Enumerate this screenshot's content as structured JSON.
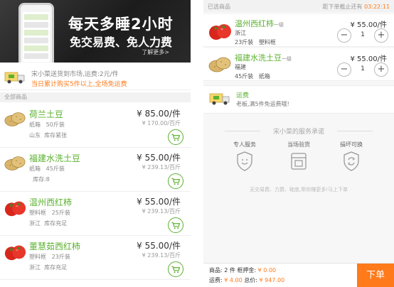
{
  "banner": {
    "title": "每天多睡2小时",
    "subtitle": "免交易费、免人力费",
    "more": "了解更多>"
  },
  "notice": {
    "line1": "宋小菜送货到市场,运费:2元/件",
    "line2": "当日累计购买5件以上,全场免运费"
  },
  "products_header": "全部商品",
  "products": [
    {
      "name": "荷兰土豆",
      "pack": "纸箱",
      "weight": "50斤装",
      "origin": "山东",
      "stock": "库存紧张",
      "price": "¥ 85.00/件",
      "unit_price": "¥ 170.00/百斤",
      "image": "potato"
    },
    {
      "name": "福建水洗土豆",
      "pack": "纸箱",
      "weight": "45斤装",
      "origin": "",
      "stock": "库存:8",
      "price": "¥ 55.00/件",
      "unit_price": "¥ 239.13/百斤",
      "image": "potato"
    },
    {
      "name": "温州西红柿",
      "pack": "塑料框",
      "weight": "25斤装",
      "origin": "浙江",
      "stock": "库存充足",
      "price": "¥ 55.00/件",
      "unit_price": "¥ 239.13/百斤",
      "image": "tomato"
    },
    {
      "name": "董慧茹西红柿",
      "pack": "塑料框",
      "weight": "23斤装",
      "origin": "浙江",
      "stock": "库存充足",
      "price": "¥ 55.00/件",
      "unit_price": "¥ 239.13/百斤",
      "image": "tomato"
    }
  ],
  "cart_header": {
    "left": "已选商品",
    "countdown_label": "距下单截止还有",
    "countdown": "03:22:11"
  },
  "cart_items": [
    {
      "name": "温州西红柿",
      "grade": "一级",
      "origin": "浙江",
      "weight": "23斤装",
      "pack": "塑料框",
      "price": "¥ 55.00/件",
      "qty": "1",
      "image": "tomato"
    },
    {
      "name": "福建水洗土豆",
      "grade": "一级",
      "origin": "福建",
      "weight": "45斤装",
      "pack": "纸箱",
      "price": "¥ 55.00/件",
      "qty": "1",
      "image": "potato"
    }
  ],
  "shipping": {
    "label": "运费",
    "desc": "老板,满5件免运费哦!"
  },
  "services": {
    "title": "宋小菜的服务承诺",
    "items": [
      {
        "label": "专人服务",
        "icon": "smile-shield-icon"
      },
      {
        "label": "当场验货",
        "icon": "box-check-icon"
      },
      {
        "label": "損坏可换",
        "icon": "refresh-shield-icon"
      }
    ],
    "footer": "无交易费、力费、础底,帮你赚更多!马上下单"
  },
  "summary": {
    "items_text": "商品: 2 件",
    "deposit_label": "框押金:",
    "deposit": "¥ 0.00",
    "shipping_label": "运费:",
    "shipping": "¥ 4.00",
    "total_label": "总价:",
    "total": "¥ 947.00",
    "submit": "下单"
  },
  "colors": {
    "accent_green": "#5bb12f",
    "accent_orange": "#ff7a1a"
  }
}
